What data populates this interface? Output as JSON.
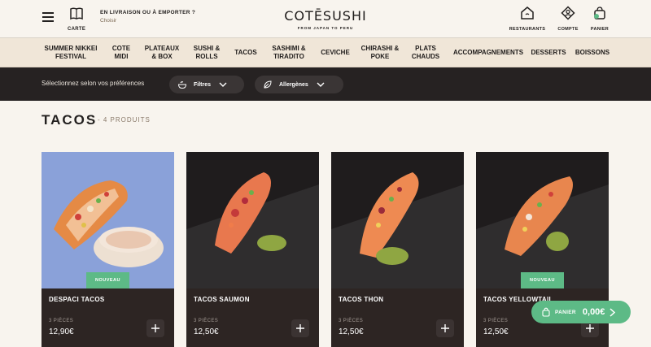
{
  "header": {
    "carte_label": "CARTE",
    "delivery_line1": "EN LIVRAISON OU À EMPORTER ?",
    "delivery_line2": "Choisir",
    "logo_name": "COTĒSUSHI",
    "logo_tagline": "FROM JAPAN TO PERU",
    "restaurants_label": "RESTAURANTS",
    "compte_label": "COMPTE",
    "panier_label": "PANIER"
  },
  "nav": {
    "items": [
      {
        "label": "SUMMER NIKKEI\nFESTIVAL"
      },
      {
        "label": "COTE\nMIDI"
      },
      {
        "label": "PLATEAUX\n& BOX"
      },
      {
        "label": "SUSHI &\nROLLS"
      },
      {
        "label": "TACOS"
      },
      {
        "label": "SASHIMI &\nTIRADITO"
      },
      {
        "label": "CEVICHE"
      },
      {
        "label": "CHIRASHI &\nPOKE"
      },
      {
        "label": "PLATS\nCHAUDS"
      },
      {
        "label": "ACCOMPAGNEMENTS"
      },
      {
        "label": "DESSERTS"
      },
      {
        "label": "BOISSONS"
      }
    ]
  },
  "filters": {
    "prompt": "Sélectionnez selon vos préférences",
    "filtres_label": "Filtres",
    "allergenes_label": "Allergènes"
  },
  "section": {
    "title": "TACOS",
    "count": "- 4 PRODUITS"
  },
  "products": [
    {
      "name": "DESPACI TACOS",
      "qty": "3 PIÈCES",
      "price": "12,90€",
      "badge": "NOUVEAU"
    },
    {
      "name": "TACOS SAUMON",
      "qty": "3 PIÈCES",
      "price": "12,50€",
      "badge": ""
    },
    {
      "name": "TACOS THON",
      "qty": "3 PIÈCES",
      "price": "12,50€",
      "badge": ""
    },
    {
      "name": "TACOS YELLOWTAIL",
      "qty": "3 PIÈCES",
      "price": "12,50€",
      "badge": "NOUVEAU"
    }
  ],
  "cart": {
    "label": "PANIER",
    "amount": "0,00€"
  },
  "colors": {
    "accent_green": "#5dba86",
    "dark_bar": "#262222",
    "nav_bg": "#f0e6d8",
    "page_bg": "#f8f4ee"
  }
}
